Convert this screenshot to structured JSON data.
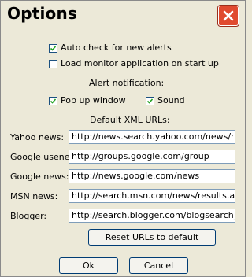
{
  "window": {
    "title": "Options"
  },
  "options": {
    "auto_check": {
      "label": "Auto check for new alerts",
      "checked": true
    },
    "load_monitor": {
      "label": "Load monitor application on start up",
      "checked": false
    }
  },
  "alert": {
    "heading": "Alert notification:",
    "popup": {
      "label": "Pop up window",
      "checked": true
    },
    "sound": {
      "label": "Sound",
      "checked": true
    }
  },
  "urls": {
    "heading": "Default XML URLs:",
    "items": [
      {
        "label": "Yahoo news:",
        "value": "http://news.search.yahoo.com/news/rss"
      },
      {
        "label": "Google usenet:",
        "value": "http://groups.google.com/group"
      },
      {
        "label": "Google news:",
        "value": "http://news.google.com/news"
      },
      {
        "label": "MSN news:",
        "value": "http://search.msn.com/news/results.aspx"
      },
      {
        "label": "Blogger:",
        "value": "http://search.blogger.com/blogsearch_feeds"
      }
    ]
  },
  "buttons": {
    "reset": "Reset URLs to default",
    "ok": "Ok",
    "cancel": "Cancel"
  }
}
